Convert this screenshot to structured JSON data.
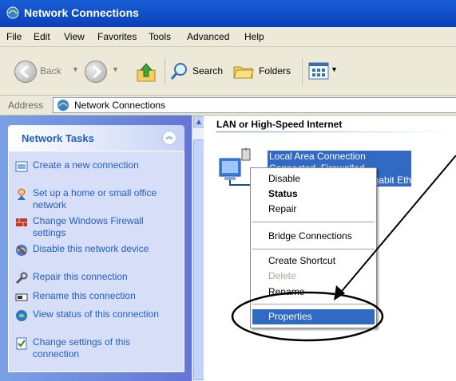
{
  "window": {
    "title": "Network Connections"
  },
  "menubar": {
    "items": [
      "File",
      "Edit",
      "View",
      "Favorites",
      "Tools",
      "Advanced",
      "Help"
    ]
  },
  "toolbar": {
    "back_label": "Back",
    "search_label": "Search",
    "folders_label": "Folders"
  },
  "address": {
    "label": "Address",
    "value": "Network Connections"
  },
  "task_pane": {
    "title": "Network Tasks",
    "tasks": [
      {
        "label": "Create a new connection",
        "icon": "new-connection-icon"
      },
      {
        "label": "Set up a home or small office network",
        "icon": "home-network-icon"
      },
      {
        "label": "Change Windows Firewall settings",
        "icon": "firewall-icon"
      },
      {
        "label": "Disable this network device",
        "icon": "disable-device-icon"
      },
      {
        "label": "Repair this connection",
        "icon": "repair-icon"
      },
      {
        "label": "Rename this connection",
        "icon": "rename-icon"
      },
      {
        "label": "View status of this connection",
        "icon": "status-icon"
      },
      {
        "label": "Change settings of this connection",
        "icon": "settings-icon"
      }
    ]
  },
  "content": {
    "group_title": "LAN or High-Speed Internet",
    "connection": {
      "name": "Local Area Connection",
      "line2": "Connected, Firewalled",
      "line3": "Broadcom NetXtreme Gigabit Ethernet Manageme..."
    }
  },
  "context_menu": {
    "items": [
      {
        "label": "Disable",
        "style": "normal"
      },
      {
        "label": "Status",
        "style": "bold"
      },
      {
        "label": "Repair",
        "style": "normal"
      },
      {
        "label": "Bridge Connections",
        "style": "normal"
      },
      {
        "label": "Create Shortcut",
        "style": "normal"
      },
      {
        "label": "Delete",
        "style": "disabled"
      },
      {
        "label": "Rename",
        "style": "normal"
      },
      {
        "label": "Properties",
        "style": "selected"
      }
    ]
  },
  "colors": {
    "title_bar": "#0a3fb8",
    "selection": "#316ac5",
    "task_link": "#215dc6",
    "annotation": "#000000"
  }
}
